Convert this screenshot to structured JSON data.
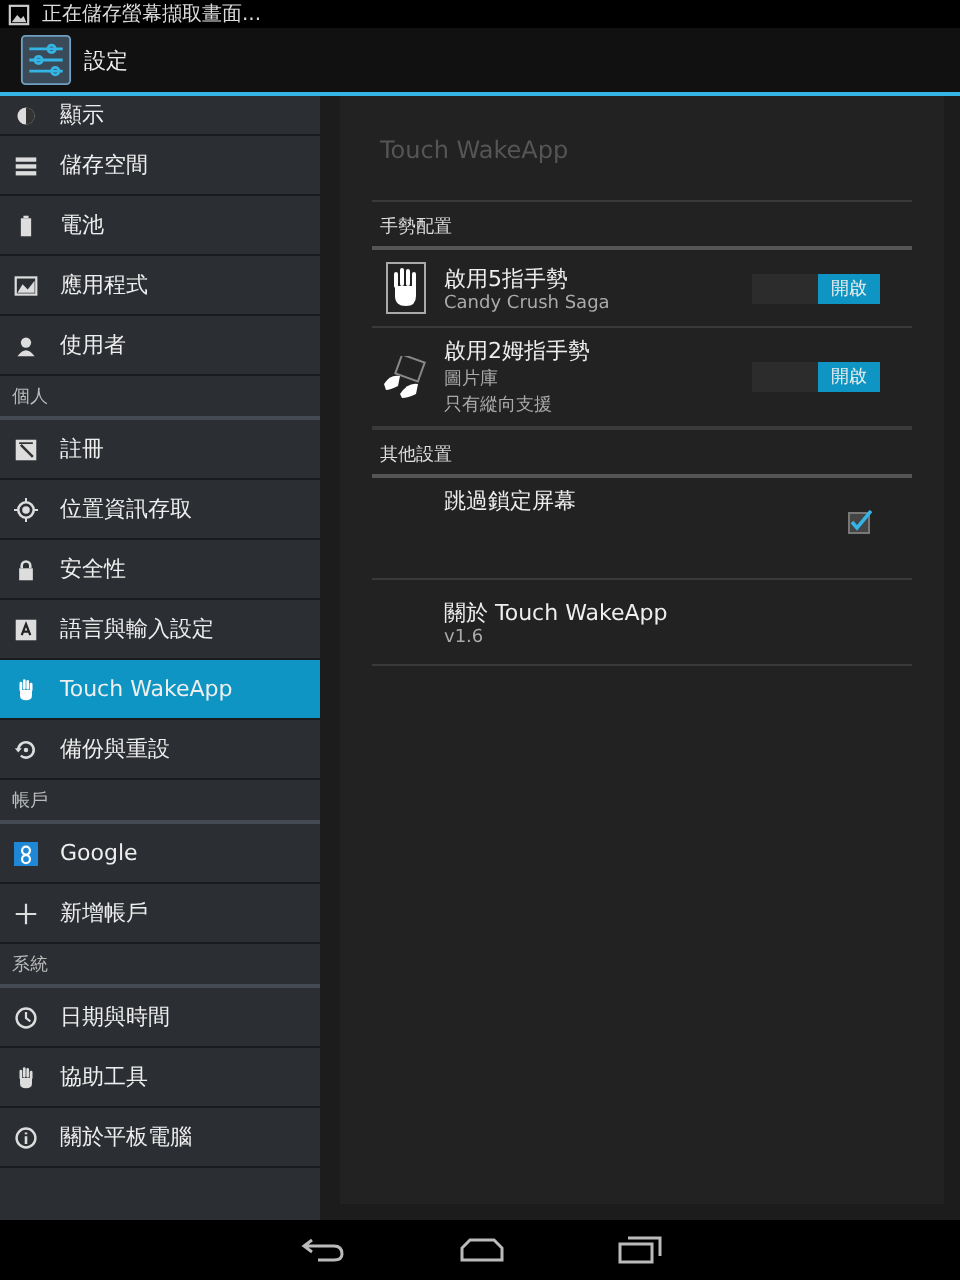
{
  "status_bar": {
    "notification": "正在儲存螢幕擷取畫面..."
  },
  "action_bar": {
    "title": "設定"
  },
  "sidebar": {
    "items": [
      {
        "kind": "item",
        "label": "顯示",
        "selected": false
      },
      {
        "kind": "item",
        "label": "儲存空間",
        "selected": false
      },
      {
        "kind": "item",
        "label": "電池",
        "selected": false
      },
      {
        "kind": "item",
        "label": "應用程式",
        "selected": false
      },
      {
        "kind": "item",
        "label": "使用者",
        "selected": false
      },
      {
        "kind": "header",
        "label": "個人"
      },
      {
        "kind": "item",
        "label": "註冊",
        "selected": false
      },
      {
        "kind": "item",
        "label": "位置資訊存取",
        "selected": false
      },
      {
        "kind": "item",
        "label": "安全性",
        "selected": false
      },
      {
        "kind": "item",
        "label": "語言與輸入設定",
        "selected": false
      },
      {
        "kind": "item",
        "label": "Touch WakeApp",
        "selected": true
      },
      {
        "kind": "item",
        "label": "備份與重設",
        "selected": false
      },
      {
        "kind": "header",
        "label": "帳戶"
      },
      {
        "kind": "item",
        "label": "Google",
        "selected": false
      },
      {
        "kind": "item",
        "label": "新增帳戶",
        "selected": false
      },
      {
        "kind": "header",
        "label": "系統"
      },
      {
        "kind": "item",
        "label": "日期與時間",
        "selected": false
      },
      {
        "kind": "item",
        "label": "協助工具",
        "selected": false
      },
      {
        "kind": "item",
        "label": "關於平板電腦",
        "selected": false
      }
    ]
  },
  "detail": {
    "title": "Touch WakeApp",
    "sections": [
      {
        "header": "手勢配置",
        "rows": [
          {
            "kind": "toggle",
            "title": "啟用5指手勢",
            "summary": [
              "Candy Crush Saga"
            ],
            "switch": {
              "label": "開啟",
              "on": true
            }
          },
          {
            "kind": "toggle",
            "title": "啟用2姆指手勢",
            "summary": [
              "圖片庫",
              "只有縱向支援"
            ],
            "switch": {
              "label": "開啟",
              "on": true
            }
          }
        ]
      },
      {
        "header": "其他設置",
        "rows": [
          {
            "kind": "checkbox",
            "title": "跳過鎖定屏幕",
            "checked": true
          },
          {
            "kind": "info",
            "title": "關於 Touch WakeApp",
            "summary": [
              "v1.6"
            ]
          }
        ]
      }
    ]
  }
}
